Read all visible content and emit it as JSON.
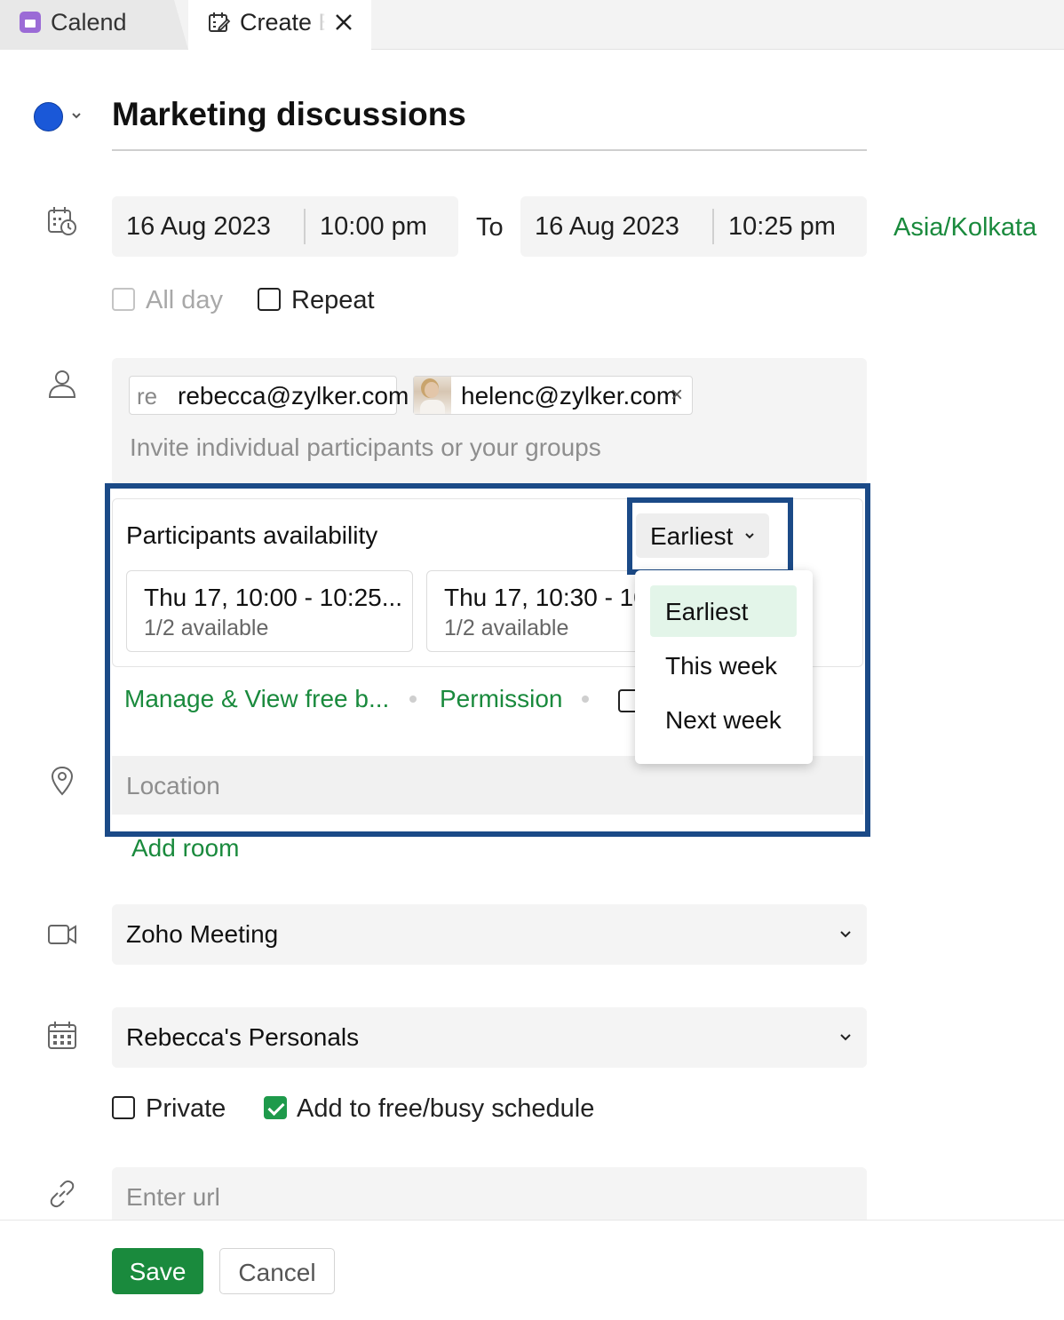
{
  "tabs": [
    {
      "label": "Calend"
    },
    {
      "label": "Create Event"
    }
  ],
  "event": {
    "title": "Marketing discussions",
    "color": "#1a58d8"
  },
  "datetime": {
    "start_date": "16 Aug 2023",
    "start_time": "10:00 pm",
    "to_label": "To",
    "end_date": "16 Aug 2023",
    "end_time": "10:25 pm",
    "timezone": "Asia/Kolkata"
  },
  "options": {
    "all_day_label": "All day",
    "repeat_label": "Repeat"
  },
  "participants": {
    "chips": [
      {
        "initials": "re",
        "email": "rebecca@zylker.com"
      },
      {
        "email": "helenc@zylker.com",
        "remove": "×"
      }
    ],
    "placeholder": "Invite individual participants or your groups"
  },
  "availability": {
    "title": "Participants availability",
    "filter_selected": "Earliest",
    "slots": [
      {
        "time": "Thu 17, 10:00 - 10:25...",
        "availability": "1/2 available"
      },
      {
        "time": "Thu 17, 10:30 - 10:55",
        "availability": "1/2 available"
      }
    ],
    "links": {
      "manage": "Manage & View free b...",
      "permission": "Permission"
    },
    "menu": [
      "Earliest",
      "This week",
      "Next week"
    ]
  },
  "location": {
    "placeholder": "Location",
    "add_room": "Add room"
  },
  "meeting": {
    "provider": "Zoho Meeting"
  },
  "calendar": {
    "name": "Rebecca's Personals"
  },
  "privacy": {
    "private_label": "Private",
    "freebusy_label": "Add to free/busy schedule",
    "freebusy_checked": true
  },
  "url": {
    "placeholder": "Enter url"
  },
  "footer": {
    "save_label": "Save",
    "cancel_label": "Cancel"
  },
  "colors": {
    "accent_green": "#1a8a3d",
    "highlight_border": "#1b4a87",
    "selected_menu_bg": "#e3f5e9"
  }
}
